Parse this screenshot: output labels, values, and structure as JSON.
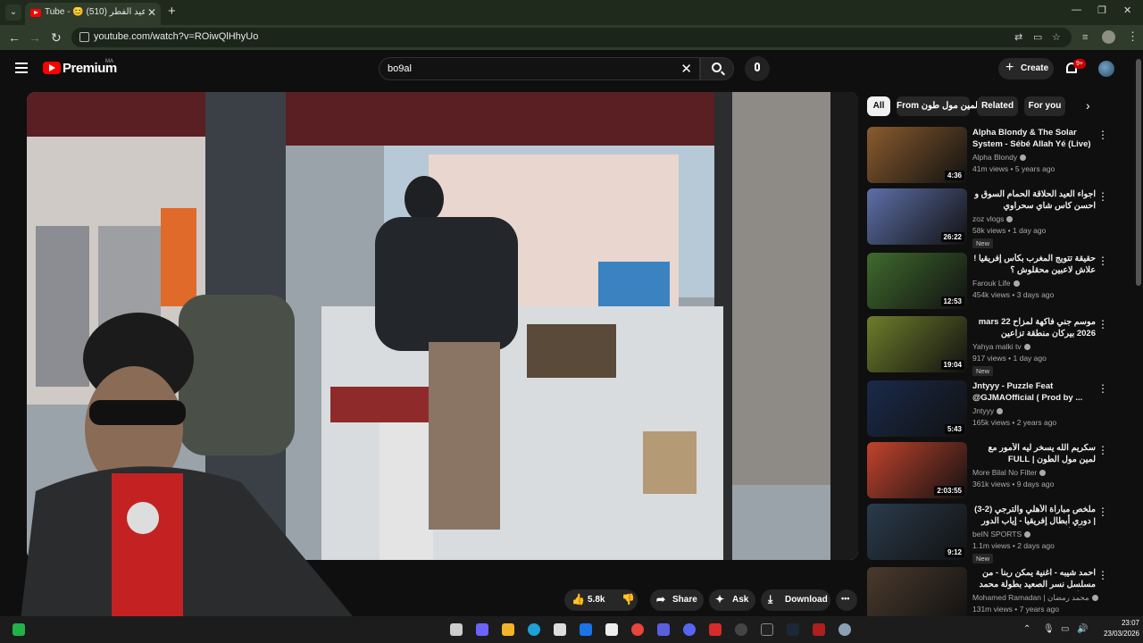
{
  "browser": {
    "tab_title": "Tube - 😊 اجواء عيد الفطر (510)",
    "url": "youtube.com/watch?v=ROiwQlHhyUo",
    "new_tab": "+",
    "close_tab": "✕"
  },
  "header": {
    "logo": "Premium",
    "region": "MA",
    "search_value": "bo9al",
    "create_label": "Create",
    "notifications_badge": "9+"
  },
  "actions": {
    "likes": "5.8k",
    "share": "Share",
    "ask": "Ask",
    "download": "Download",
    "more": "•••"
  },
  "chips": [
    "All",
    "From لمين مول طون",
    "Related",
    "For you"
  ],
  "recommendations": [
    {
      "title": "Alpha Blondy & The Solar System - Sébé Allah Yé (Live)",
      "channel": "Alpha Blondy",
      "meta": "41m views • 5 years ago",
      "duration": "4:36",
      "new": "",
      "rtl": false,
      "thumb_color": "#8a5b2d"
    },
    {
      "title": "اجواء العيد الحلاقة الحمام السوق و احسن كاس شاي سحراوي",
      "channel": "zoz vlogs",
      "meta": "58k views • 1 day ago",
      "duration": "26:22",
      "new": "New",
      "rtl": true,
      "thumb_color": "#5d6fa8"
    },
    {
      "title": "حقيقة تتويج المغرب بكأس إفريقيا ! علاش لاعبين محقلوش ؟",
      "channel": "Farouk Life",
      "meta": "454k views • 3 days ago",
      "duration": "12:53",
      "new": "",
      "rtl": true,
      "thumb_color": "#3f6b2e"
    },
    {
      "title": "موسم جني فاكهة لمزاح 22 mars 2026 بيركان منطقة تزاعين",
      "channel": "Yahya malki tv",
      "meta": "917 views • 1 day ago",
      "duration": "19:04",
      "new": "New",
      "rtl": true,
      "thumb_color": "#6e7d2a"
    },
    {
      "title": "Jntyyy - Puzzle Feat @GJMAOfficial ( Prod by ...",
      "channel": "Jntyyy",
      "meta": "165k views • 2 years ago",
      "duration": "5:43",
      "new": "",
      "rtl": false,
      "thumb_color": "#1a2a4a"
    },
    {
      "title": "سكريم الله يسخر ليه الأمور مع لمين مول الطون | FULL STREAM",
      "channel": "More Bilal No Filter",
      "meta": "361k views • 9 days ago",
      "duration": "2:03:55",
      "new": "",
      "rtl": true,
      "thumb_color": "#c2432c"
    },
    {
      "title": "ملخص مباراة الأهلي والترجي (2-3) | دوري أبطال إفريقيا - إياب الدور ربع النهائي",
      "channel": "beIN SPORTS",
      "meta": "1.1m views • 2 days ago",
      "duration": "9:12",
      "new": "New",
      "rtl": true,
      "thumb_color": "#2a3b4c"
    },
    {
      "title": "احمد شيبه - اغنية يمكن ربنا - من مسلسل نسر الصعيد بطولة محمد رمضان | Nesr El ...",
      "channel": "Mohamed Ramadan | محمد رمضان",
      "meta": "131m views • 7 years ago",
      "duration": "",
      "new": "",
      "rtl": true,
      "thumb_color": "#4a3a2c"
    }
  ],
  "taskbar": {
    "time": "23:07",
    "date": "23/03/2026"
  },
  "colors": {
    "background": "#0f0f0f",
    "brand_red": "#ff0000",
    "chrome_green": "#2f3b2b"
  }
}
